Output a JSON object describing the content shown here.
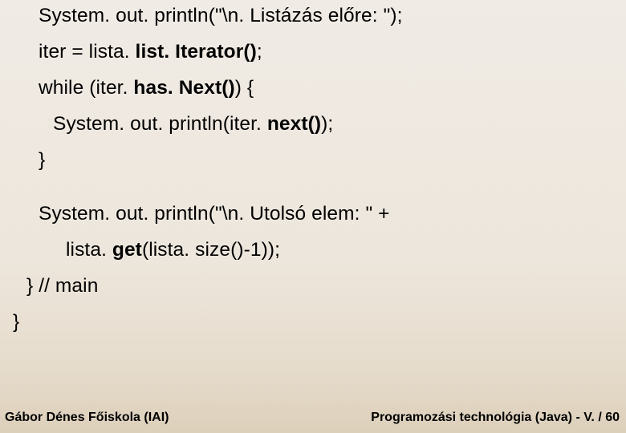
{
  "code": {
    "l1a": "System. out. println(\"\\n. Listázás előre: \");",
    "l2a": "iter = lista. ",
    "l2b": "list. Iterator()",
    "l2c": ";",
    "l3a": "while (iter. ",
    "l3b": "has. Next()",
    "l3c": ") {",
    "l4a": "System. out. println(iter. ",
    "l4b": "next()",
    "l4c": ");",
    "l5a": "}",
    "l6a": "System. out. println(\"\\n. Utolsó elem: \" +",
    "l7a": "lista. ",
    "l7b": "get",
    "l7c": "(lista. size()-1));",
    "l8a": "} // main",
    "l9a": "}"
  },
  "footer": {
    "left": "Gábor Dénes Főiskola (IAI)",
    "right": "Programozási technológia (Java)  -  V. / 60"
  }
}
